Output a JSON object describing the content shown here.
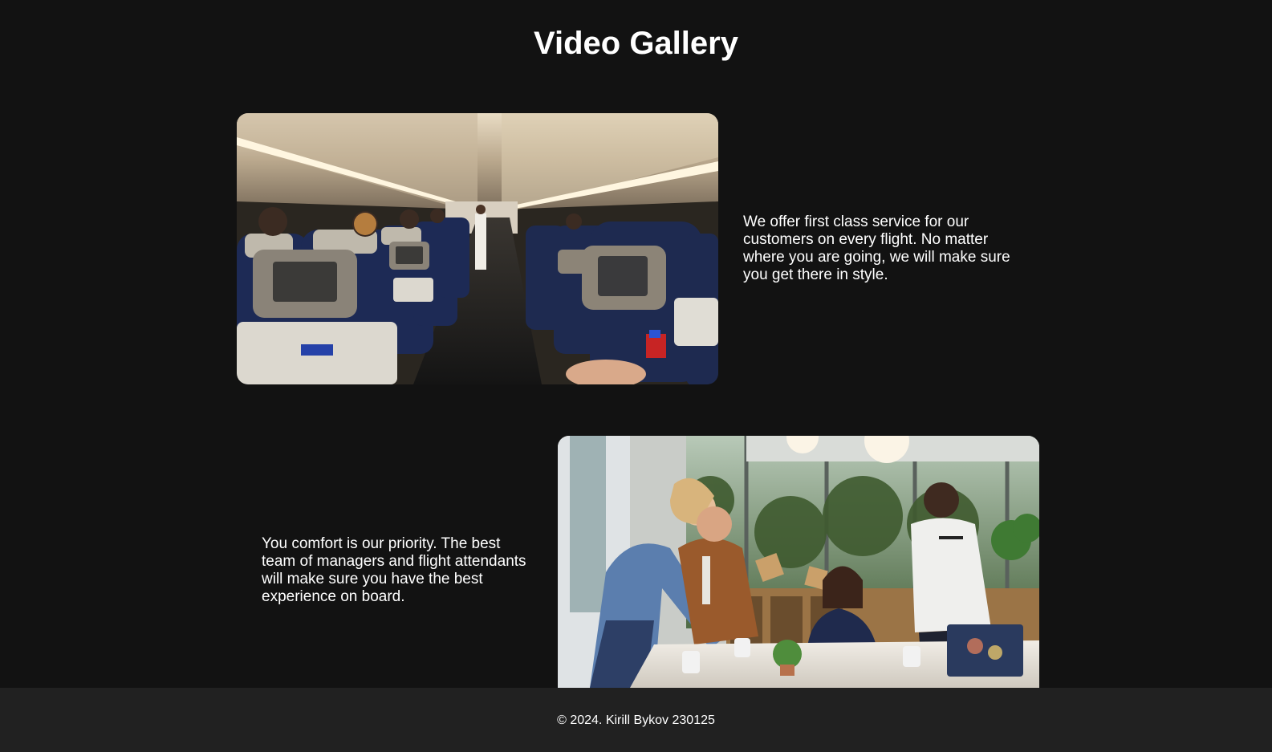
{
  "page": {
    "title": "Video Gallery"
  },
  "gallery": {
    "items": [
      {
        "media_icon": "airplane-cabin-image",
        "caption": "We offer first class service for our customers on every flight. No matter where you are going, we will make sure you get there in style."
      },
      {
        "media_icon": "office-meeting-image",
        "caption": "You comfort is our priority. The best team of managers and flight attendants will make sure you have the best experience on board."
      }
    ]
  },
  "footer": {
    "text": "© 2024. Kirill Bykov 230125"
  },
  "colors": {
    "background": "#121212",
    "footer_background": "#212121",
    "text": "#ffffff"
  }
}
